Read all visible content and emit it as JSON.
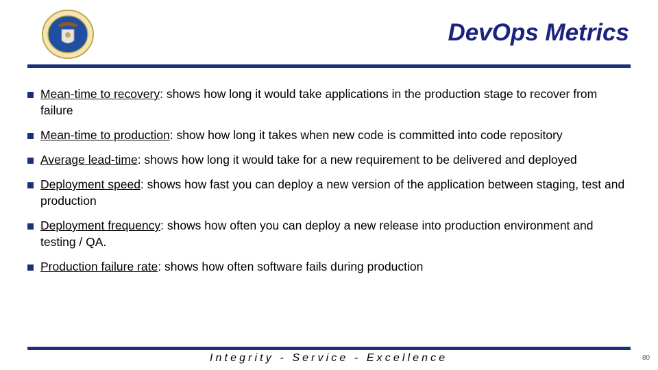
{
  "slide": {
    "title": "DevOps Metrics",
    "logo": "department-of-the-air-force-seal",
    "bullets": [
      {
        "term": "Mean-time to recovery",
        "text": ": shows how long it would take applications in the production stage to recover from failure"
      },
      {
        "term": "Mean-time to production",
        "text": ": show how long it takes when new code is committed into code repository"
      },
      {
        "term": "Average lead-time",
        "text": ": shows how long it would take for a new requirement to be delivered and deployed"
      },
      {
        "term": "Deployment speed",
        "text": ": shows how fast you can deploy a new version of the application between staging, test and production"
      },
      {
        "term": "Deployment frequency",
        "text": ": shows how often you can deploy a new release into production environment and testing / QA."
      },
      {
        "term": "Production failure rate",
        "text": ": shows how often software fails during production"
      }
    ],
    "footer": "Integrity - Service - Excellence",
    "page_number": "80",
    "colors": {
      "title": "#1a237e",
      "rule": "#1b2f7a",
      "seal_blue": "#1f4fa3",
      "seal_gold": "#c9a74a"
    }
  }
}
